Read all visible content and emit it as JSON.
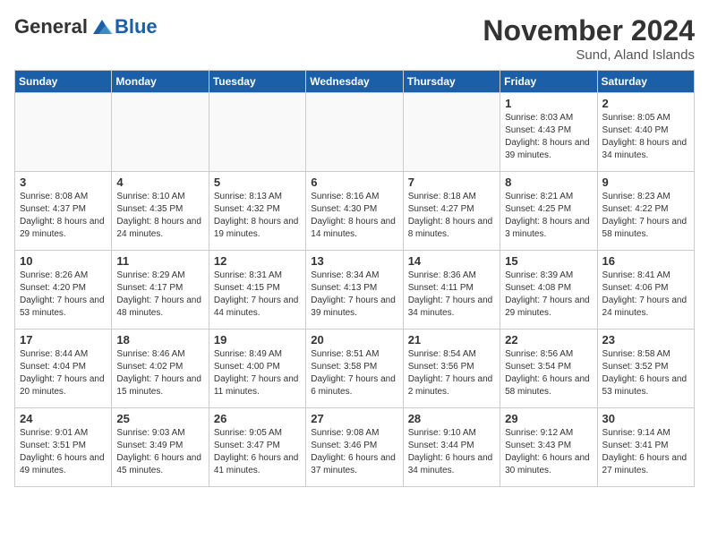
{
  "header": {
    "logo_general": "General",
    "logo_blue": "Blue",
    "month_title": "November 2024",
    "location": "Sund, Aland Islands"
  },
  "weekdays": [
    "Sunday",
    "Monday",
    "Tuesday",
    "Wednesday",
    "Thursday",
    "Friday",
    "Saturday"
  ],
  "weeks": [
    [
      {
        "day": "",
        "info": ""
      },
      {
        "day": "",
        "info": ""
      },
      {
        "day": "",
        "info": ""
      },
      {
        "day": "",
        "info": ""
      },
      {
        "day": "",
        "info": ""
      },
      {
        "day": "1",
        "info": "Sunrise: 8:03 AM\nSunset: 4:43 PM\nDaylight: 8 hours and 39 minutes."
      },
      {
        "day": "2",
        "info": "Sunrise: 8:05 AM\nSunset: 4:40 PM\nDaylight: 8 hours and 34 minutes."
      }
    ],
    [
      {
        "day": "3",
        "info": "Sunrise: 8:08 AM\nSunset: 4:37 PM\nDaylight: 8 hours and 29 minutes."
      },
      {
        "day": "4",
        "info": "Sunrise: 8:10 AM\nSunset: 4:35 PM\nDaylight: 8 hours and 24 minutes."
      },
      {
        "day": "5",
        "info": "Sunrise: 8:13 AM\nSunset: 4:32 PM\nDaylight: 8 hours and 19 minutes."
      },
      {
        "day": "6",
        "info": "Sunrise: 8:16 AM\nSunset: 4:30 PM\nDaylight: 8 hours and 14 minutes."
      },
      {
        "day": "7",
        "info": "Sunrise: 8:18 AM\nSunset: 4:27 PM\nDaylight: 8 hours and 8 minutes."
      },
      {
        "day": "8",
        "info": "Sunrise: 8:21 AM\nSunset: 4:25 PM\nDaylight: 8 hours and 3 minutes."
      },
      {
        "day": "9",
        "info": "Sunrise: 8:23 AM\nSunset: 4:22 PM\nDaylight: 7 hours and 58 minutes."
      }
    ],
    [
      {
        "day": "10",
        "info": "Sunrise: 8:26 AM\nSunset: 4:20 PM\nDaylight: 7 hours and 53 minutes."
      },
      {
        "day": "11",
        "info": "Sunrise: 8:29 AM\nSunset: 4:17 PM\nDaylight: 7 hours and 48 minutes."
      },
      {
        "day": "12",
        "info": "Sunrise: 8:31 AM\nSunset: 4:15 PM\nDaylight: 7 hours and 44 minutes."
      },
      {
        "day": "13",
        "info": "Sunrise: 8:34 AM\nSunset: 4:13 PM\nDaylight: 7 hours and 39 minutes."
      },
      {
        "day": "14",
        "info": "Sunrise: 8:36 AM\nSunset: 4:11 PM\nDaylight: 7 hours and 34 minutes."
      },
      {
        "day": "15",
        "info": "Sunrise: 8:39 AM\nSunset: 4:08 PM\nDaylight: 7 hours and 29 minutes."
      },
      {
        "day": "16",
        "info": "Sunrise: 8:41 AM\nSunset: 4:06 PM\nDaylight: 7 hours and 24 minutes."
      }
    ],
    [
      {
        "day": "17",
        "info": "Sunrise: 8:44 AM\nSunset: 4:04 PM\nDaylight: 7 hours and 20 minutes."
      },
      {
        "day": "18",
        "info": "Sunrise: 8:46 AM\nSunset: 4:02 PM\nDaylight: 7 hours and 15 minutes."
      },
      {
        "day": "19",
        "info": "Sunrise: 8:49 AM\nSunset: 4:00 PM\nDaylight: 7 hours and 11 minutes."
      },
      {
        "day": "20",
        "info": "Sunrise: 8:51 AM\nSunset: 3:58 PM\nDaylight: 7 hours and 6 minutes."
      },
      {
        "day": "21",
        "info": "Sunrise: 8:54 AM\nSunset: 3:56 PM\nDaylight: 7 hours and 2 minutes."
      },
      {
        "day": "22",
        "info": "Sunrise: 8:56 AM\nSunset: 3:54 PM\nDaylight: 6 hours and 58 minutes."
      },
      {
        "day": "23",
        "info": "Sunrise: 8:58 AM\nSunset: 3:52 PM\nDaylight: 6 hours and 53 minutes."
      }
    ],
    [
      {
        "day": "24",
        "info": "Sunrise: 9:01 AM\nSunset: 3:51 PM\nDaylight: 6 hours and 49 minutes."
      },
      {
        "day": "25",
        "info": "Sunrise: 9:03 AM\nSunset: 3:49 PM\nDaylight: 6 hours and 45 minutes."
      },
      {
        "day": "26",
        "info": "Sunrise: 9:05 AM\nSunset: 3:47 PM\nDaylight: 6 hours and 41 minutes."
      },
      {
        "day": "27",
        "info": "Sunrise: 9:08 AM\nSunset: 3:46 PM\nDaylight: 6 hours and 37 minutes."
      },
      {
        "day": "28",
        "info": "Sunrise: 9:10 AM\nSunset: 3:44 PM\nDaylight: 6 hours and 34 minutes."
      },
      {
        "day": "29",
        "info": "Sunrise: 9:12 AM\nSunset: 3:43 PM\nDaylight: 6 hours and 30 minutes."
      },
      {
        "day": "30",
        "info": "Sunrise: 9:14 AM\nSunset: 3:41 PM\nDaylight: 6 hours and 27 minutes."
      }
    ]
  ]
}
